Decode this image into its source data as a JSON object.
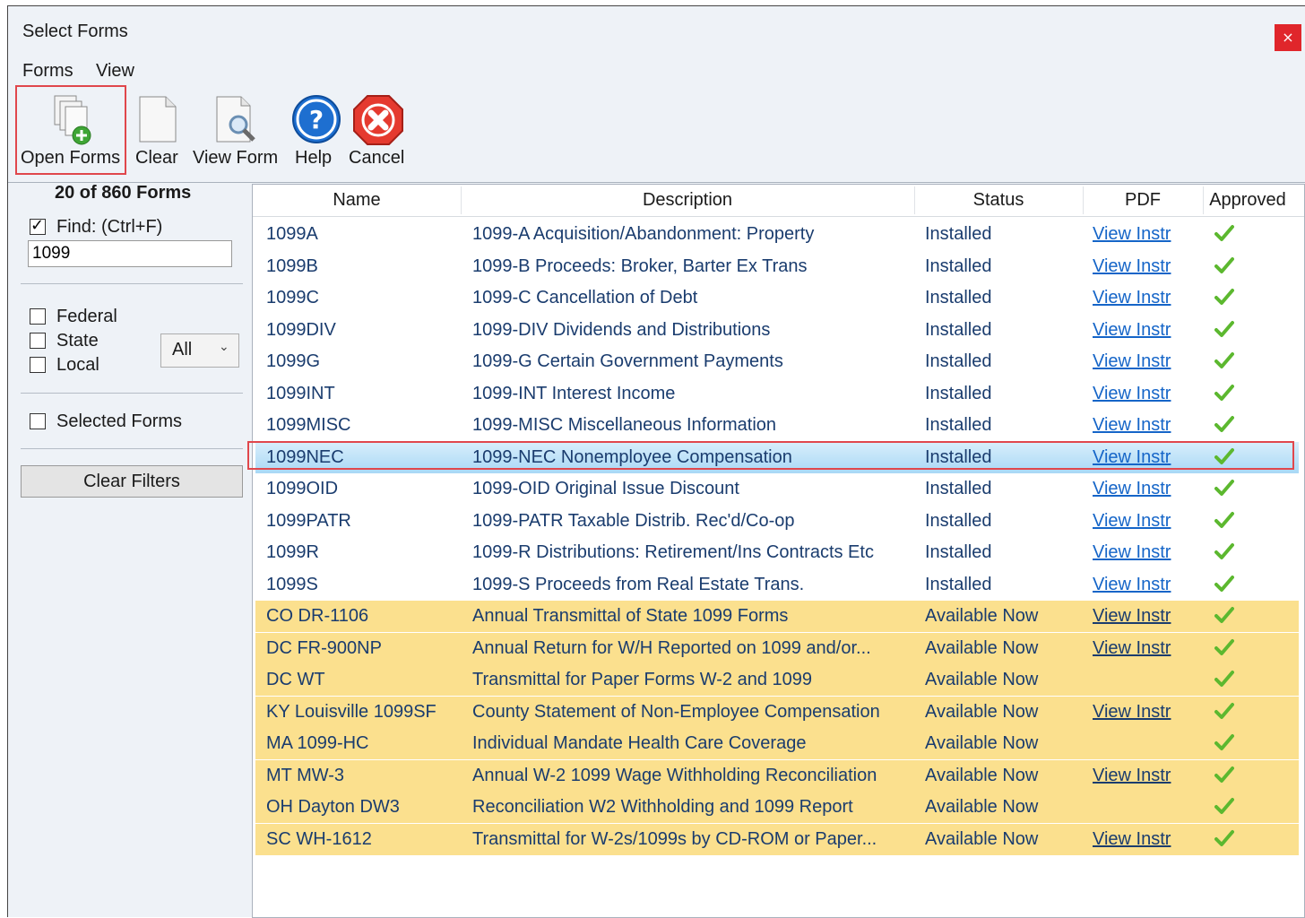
{
  "window": {
    "title": "Select Forms",
    "close_label": "×"
  },
  "menu": {
    "items": [
      "Forms",
      "View"
    ]
  },
  "toolbar": {
    "open_forms": "Open Forms",
    "clear": "Clear",
    "view_form": "View Form",
    "help": "Help",
    "cancel": "Cancel"
  },
  "filters": {
    "count_text": "20 of 860  Forms",
    "find_label": "Find: (Ctrl+F)",
    "find_checked": true,
    "find_value": "1099",
    "federal_label": "Federal",
    "state_label": "State",
    "local_label": "Local",
    "state_select_value": "All",
    "selected_forms_label": "Selected Forms",
    "clear_filters_label": "Clear Filters"
  },
  "grid": {
    "columns": [
      "Name",
      "Description",
      "Status",
      "PDF",
      "Approved"
    ],
    "rows": [
      {
        "name": "1099A",
        "desc": "1099-A Acquisition/Abandonment: Property",
        "status": "Installed",
        "pdf": "View Instr",
        "approved": true,
        "type": "installed"
      },
      {
        "name": "1099B",
        "desc": "1099-B Proceeds: Broker, Barter Ex Trans",
        "status": "Installed",
        "pdf": "View Instr",
        "approved": true,
        "type": "installed"
      },
      {
        "name": "1099C",
        "desc": "1099-C Cancellation of Debt",
        "status": "Installed",
        "pdf": "View Instr",
        "approved": true,
        "type": "installed"
      },
      {
        "name": "1099DIV",
        "desc": "1099-DIV Dividends and Distributions",
        "status": "Installed",
        "pdf": "View Instr",
        "approved": true,
        "type": "installed"
      },
      {
        "name": "1099G",
        "desc": "1099-G Certain Government Payments",
        "status": "Installed",
        "pdf": "View Instr",
        "approved": true,
        "type": "installed"
      },
      {
        "name": "1099INT",
        "desc": "1099-INT Interest Income",
        "status": "Installed",
        "pdf": "View Instr",
        "approved": true,
        "type": "installed"
      },
      {
        "name": "1099MISC",
        "desc": "1099-MISC Miscellaneous Information",
        "status": "Installed",
        "pdf": "View Instr",
        "approved": true,
        "type": "installed"
      },
      {
        "name": "1099NEC",
        "desc": "1099-NEC Nonemployee Compensation",
        "status": "Installed",
        "pdf": "View Instr",
        "approved": true,
        "type": "selected"
      },
      {
        "name": "1099OID",
        "desc": "1099-OID Original Issue Discount",
        "status": "Installed",
        "pdf": "View Instr",
        "approved": true,
        "type": "installed"
      },
      {
        "name": "1099PATR",
        "desc": "1099-PATR Taxable Distrib. Rec'd/Co-op",
        "status": "Installed",
        "pdf": "View Instr",
        "approved": true,
        "type": "installed"
      },
      {
        "name": "1099R",
        "desc": "1099-R Distributions: Retirement/Ins Contracts Etc",
        "status": "Installed",
        "pdf": "View Instr",
        "approved": true,
        "type": "installed"
      },
      {
        "name": "1099S",
        "desc": "1099-S Proceeds from Real Estate Trans.",
        "status": "Installed",
        "pdf": "View Instr",
        "approved": true,
        "type": "installed"
      },
      {
        "name": "CO DR-1106",
        "desc": "Annual Transmittal of State 1099 Forms",
        "status": "Available Now",
        "pdf": "View Instr",
        "approved": true,
        "type": "available"
      },
      {
        "name": "DC FR-900NP",
        "desc": "Annual Return for W/H Reported on 1099 and/or...",
        "status": "Available Now",
        "pdf": "View Instr",
        "approved": true,
        "type": "available"
      },
      {
        "name": "DC WT",
        "desc": "Transmittal for Paper Forms W-2 and 1099",
        "status": "Available Now",
        "pdf": "",
        "approved": true,
        "type": "available"
      },
      {
        "name": "KY Louisville 1099SF",
        "desc": "County Statement of Non-Employee Compensation",
        "status": "Available Now",
        "pdf": "View Instr",
        "approved": true,
        "type": "available"
      },
      {
        "name": "MA 1099-HC",
        "desc": "Individual Mandate Health Care Coverage",
        "status": "Available Now",
        "pdf": "",
        "approved": true,
        "type": "available"
      },
      {
        "name": "MT MW-3",
        "desc": "Annual W-2 1099 Wage Withholding Reconciliation",
        "status": "Available Now",
        "pdf": "View Instr",
        "approved": true,
        "type": "available"
      },
      {
        "name": "OH Dayton DW3",
        "desc": "Reconciliation W2 Withholding and 1099 Report",
        "status": "Available Now",
        "pdf": "",
        "approved": true,
        "type": "available"
      },
      {
        "name": "SC WH-1612",
        "desc": "Transmittal for W-2s/1099s by CD-ROM or Paper...",
        "status": "Available Now",
        "pdf": "View Instr",
        "approved": true,
        "type": "available"
      }
    ]
  },
  "colors": {
    "available_row": "#fbe08e",
    "selected_row": "#b9e0f8",
    "highlight_border": "#e0474c",
    "link": "#1565c8",
    "check": "#5cb82f"
  },
  "icons": {
    "open_forms": "open-forms-icon",
    "clear": "blank-page-icon",
    "view_form": "magnifier-page-icon",
    "help": "help-icon",
    "cancel": "cancel-icon",
    "approved": "checkmark-icon"
  }
}
